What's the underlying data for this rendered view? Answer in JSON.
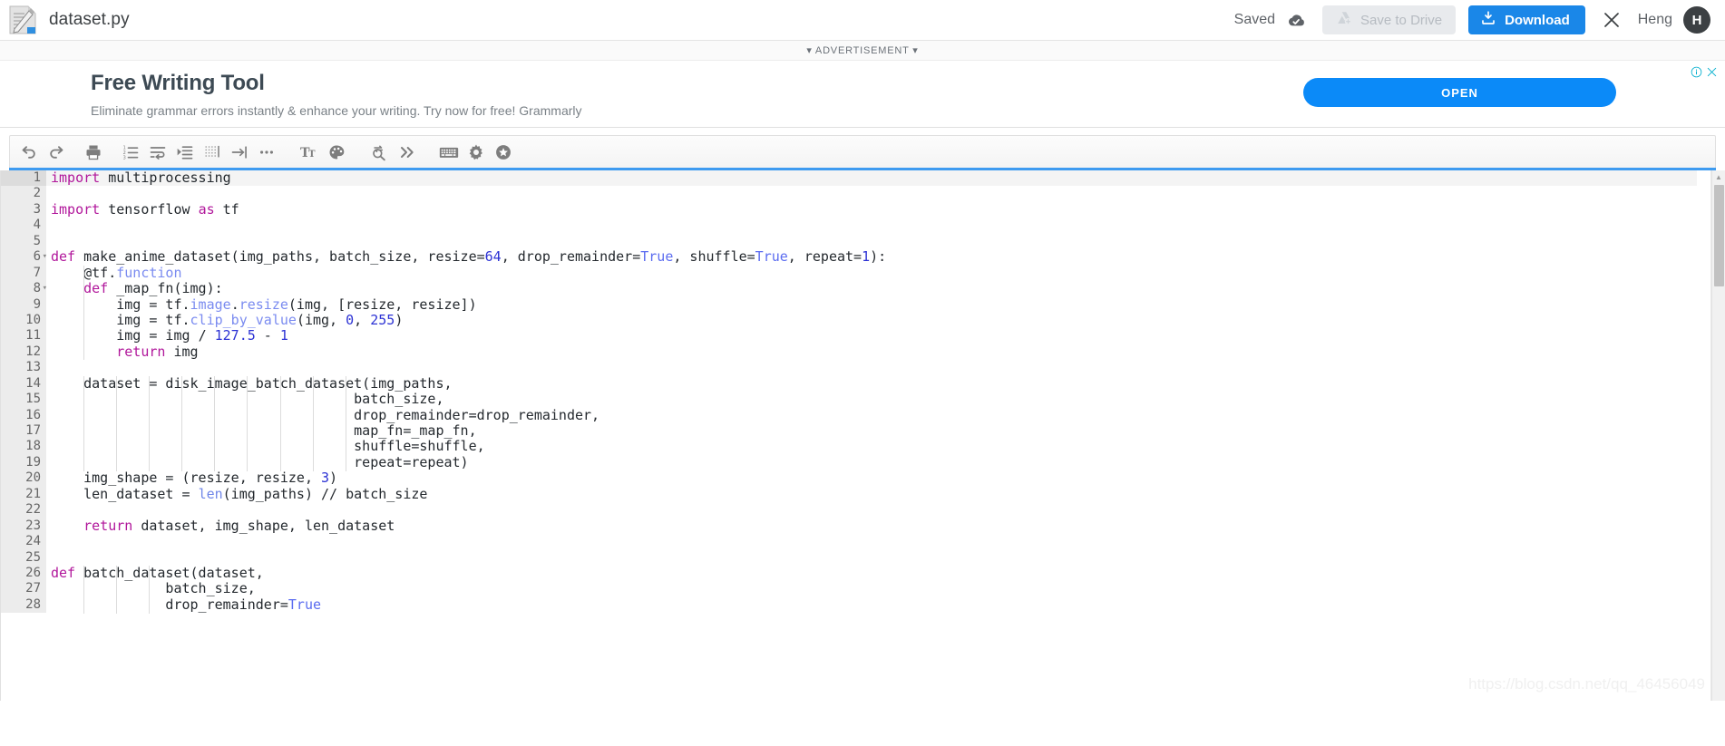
{
  "topbar": {
    "file_icon": "document-pencil-icon",
    "title": "dataset.py",
    "saved_label": "Saved",
    "cloud_icon": "cloud-check-icon",
    "save_to_drive_label": "Save to Drive",
    "drive_icon": "google-drive-add-icon",
    "download_label": "Download",
    "download_icon": "download-icon",
    "close_icon": "close-icon",
    "user_name": "Heng",
    "avatar_initial": "H",
    "accent_blue": "#1a87e8",
    "avatar_bg": "#3c4043"
  },
  "ad": {
    "label": "▾ ADVERTISEMENT ▾",
    "headline": "Free Writing Tool",
    "subtext": "Eliminate grammar errors instantly & enhance your writing. Try now for free! Grammarly",
    "cta_label": "OPEN",
    "cta_color": "#0b8af8",
    "info_icon": "info-circle-icon",
    "close_icon": "ad-close-icon"
  },
  "toolbar": {
    "items": [
      {
        "name": "undo-icon",
        "title": "Undo"
      },
      {
        "name": "redo-icon",
        "title": "Redo"
      },
      {
        "name": "print-icon",
        "title": "Print"
      },
      {
        "name": "line-numbers-icon",
        "title": "Line numbers"
      },
      {
        "name": "word-wrap-icon",
        "title": "Word wrap"
      },
      {
        "name": "indent-icon",
        "title": "Indent"
      },
      {
        "name": "whitespace-icon",
        "title": "Show whitespace"
      },
      {
        "name": "tab-size-icon",
        "title": "Tab size"
      },
      {
        "name": "more-options-icon",
        "title": "More"
      },
      {
        "name": "font-size-icon",
        "title": "Font size"
      },
      {
        "name": "theme-palette-icon",
        "title": "Theme"
      },
      {
        "name": "find-replace-icon",
        "title": "Find and replace"
      },
      {
        "name": "chevrons-right-icon",
        "title": "More tools"
      },
      {
        "name": "keyboard-icon",
        "title": "Keyboard shortcuts"
      },
      {
        "name": "settings-gear-icon",
        "title": "Settings"
      },
      {
        "name": "star-badge-icon",
        "title": "Upgrade"
      }
    ]
  },
  "editor": {
    "language": "python",
    "active_line": 1,
    "first_visible_line": 1,
    "last_visible_line": 28,
    "fold_lines": [
      6,
      8
    ],
    "lines": [
      {
        "n": 1,
        "tokens": [
          {
            "t": "import",
            "c": "kw"
          },
          {
            "t": " multiprocessing",
            "c": "op"
          }
        ]
      },
      {
        "n": 2,
        "tokens": []
      },
      {
        "n": 3,
        "tokens": [
          {
            "t": "import",
            "c": "kw"
          },
          {
            "t": " tensorflow ",
            "c": "op"
          },
          {
            "t": "as",
            "c": "kw"
          },
          {
            "t": " tf",
            "c": "op"
          }
        ]
      },
      {
        "n": 4,
        "tokens": []
      },
      {
        "n": 5,
        "tokens": []
      },
      {
        "n": 6,
        "tokens": [
          {
            "t": "def",
            "c": "kw"
          },
          {
            "t": " make_anime_dataset(img_paths, batch_size, resize=",
            "c": "op"
          },
          {
            "t": "64",
            "c": "num"
          },
          {
            "t": ", drop_remainder=",
            "c": "op"
          },
          {
            "t": "True",
            "c": "bool"
          },
          {
            "t": ", shuffle=",
            "c": "op"
          },
          {
            "t": "True",
            "c": "bool"
          },
          {
            "t": ", repeat=",
            "c": "op"
          },
          {
            "t": "1",
            "c": "num"
          },
          {
            "t": "):",
            "c": "op"
          }
        ]
      },
      {
        "n": 7,
        "tokens": [
          {
            "t": "    @",
            "c": "op"
          },
          {
            "t": "tf",
            "c": "op"
          },
          {
            "t": ".",
            "c": "op"
          },
          {
            "t": "function",
            "c": "attr"
          }
        ]
      },
      {
        "n": 8,
        "tokens": [
          {
            "t": "    ",
            "c": "op"
          },
          {
            "t": "def",
            "c": "kw"
          },
          {
            "t": " _map_fn(img):",
            "c": "op"
          }
        ]
      },
      {
        "n": 9,
        "tokens": [
          {
            "t": "        img = tf.",
            "c": "op"
          },
          {
            "t": "image",
            "c": "attr"
          },
          {
            "t": ".",
            "c": "op"
          },
          {
            "t": "resize",
            "c": "attr"
          },
          {
            "t": "(img, [resize, resize])",
            "c": "op"
          }
        ]
      },
      {
        "n": 10,
        "tokens": [
          {
            "t": "        img = tf.",
            "c": "op"
          },
          {
            "t": "clip_by_value",
            "c": "attr"
          },
          {
            "t": "(img, ",
            "c": "op"
          },
          {
            "t": "0",
            "c": "num"
          },
          {
            "t": ", ",
            "c": "op"
          },
          {
            "t": "255",
            "c": "num"
          },
          {
            "t": ")",
            "c": "op"
          }
        ]
      },
      {
        "n": 11,
        "tokens": [
          {
            "t": "        img = img ",
            "c": "op"
          },
          {
            "t": "/",
            "c": "op"
          },
          {
            "t": " ",
            "c": "op"
          },
          {
            "t": "127.5",
            "c": "num"
          },
          {
            "t": " - ",
            "c": "op"
          },
          {
            "t": "1",
            "c": "num"
          }
        ]
      },
      {
        "n": 12,
        "tokens": [
          {
            "t": "        ",
            "c": "op"
          },
          {
            "t": "return",
            "c": "kw"
          },
          {
            "t": " img",
            "c": "op"
          }
        ]
      },
      {
        "n": 13,
        "tokens": []
      },
      {
        "n": 14,
        "tokens": [
          {
            "t": "    dataset = disk_image_batch_dataset(img_paths,",
            "c": "op"
          }
        ]
      },
      {
        "n": 15,
        "tokens": [
          {
            "t": "                                     batch_size,",
            "c": "op"
          }
        ]
      },
      {
        "n": 16,
        "tokens": [
          {
            "t": "                                     drop_remainder=drop_remainder,",
            "c": "op"
          }
        ]
      },
      {
        "n": 17,
        "tokens": [
          {
            "t": "                                     map_fn=_map_fn,",
            "c": "op"
          }
        ]
      },
      {
        "n": 18,
        "tokens": [
          {
            "t": "                                     shuffle=shuffle,",
            "c": "op"
          }
        ]
      },
      {
        "n": 19,
        "tokens": [
          {
            "t": "                                     repeat=repeat)",
            "c": "op"
          }
        ]
      },
      {
        "n": 20,
        "tokens": [
          {
            "t": "    img_shape = (resize, resize, ",
            "c": "op"
          },
          {
            "t": "3",
            "c": "num"
          },
          {
            "t": ")",
            "c": "op"
          }
        ]
      },
      {
        "n": 21,
        "tokens": [
          {
            "t": "    len_dataset = ",
            "c": "op"
          },
          {
            "t": "len",
            "c": "bi"
          },
          {
            "t": "(img_paths) ",
            "c": "op"
          },
          {
            "t": "//",
            "c": "op"
          },
          {
            "t": " batch_size",
            "c": "op"
          }
        ]
      },
      {
        "n": 22,
        "tokens": []
      },
      {
        "n": 23,
        "tokens": [
          {
            "t": "    ",
            "c": "op"
          },
          {
            "t": "return",
            "c": "kw"
          },
          {
            "t": " dataset, img_shape, len_dataset",
            "c": "op"
          }
        ]
      },
      {
        "n": 24,
        "tokens": []
      },
      {
        "n": 25,
        "tokens": []
      },
      {
        "n": 26,
        "tokens": [
          {
            "t": "def",
            "c": "kw"
          },
          {
            "t": " batch_dataset(dataset,",
            "c": "op"
          }
        ]
      },
      {
        "n": 27,
        "tokens": [
          {
            "t": "              batch_size,",
            "c": "op"
          }
        ]
      },
      {
        "n": 28,
        "tokens": [
          {
            "t": "              drop_remainder=",
            "c": "op"
          },
          {
            "t": "True",
            "c": "bool"
          }
        ]
      }
    ],
    "colors": {
      "keyword": "#b1179b",
      "number": "#2c32d4",
      "boolean": "#5b6cf0",
      "attribute": "#7a8bf0",
      "builtin": "#6f86e8",
      "text": "#24292e",
      "gutter_bg": "#ececec",
      "active_line_bg": "#f4f4f4"
    }
  },
  "scrollbar": {
    "up_arrow_icon": "scroll-up-arrow-icon",
    "thumb": "vertical-scroll-thumb"
  },
  "watermark": {
    "text": "https://blog.csdn.net/qq_46456049"
  }
}
